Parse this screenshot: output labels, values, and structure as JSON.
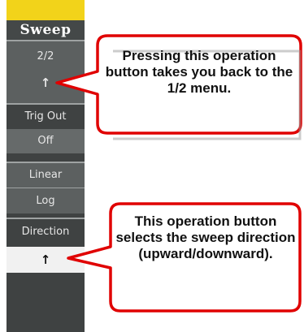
{
  "menu": {
    "title": "Sweep",
    "items": [
      {
        "label": "2/2",
        "icon": "up-arrow-icon",
        "glyph": "↑"
      },
      {
        "label": "Trig Out",
        "value": "Off"
      },
      {
        "label": "Linear"
      },
      {
        "label": "Log"
      },
      {
        "label": "Direction",
        "icon": "up-arrow-icon",
        "glyph": "↑"
      }
    ]
  },
  "callouts": [
    {
      "text": "Pressing this operation button takes you back to the 1/2 menu."
    },
    {
      "text": "This operation button selects the sweep direction (upward/downward)."
    }
  ],
  "colors": {
    "accent_top": "#f2d31a",
    "panel_bg": "#3f4242",
    "callout_border": "#e00000"
  }
}
